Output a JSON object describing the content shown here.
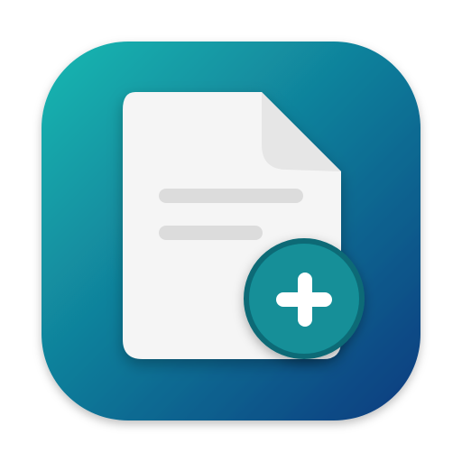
{
  "app_icon": {
    "name": "new-document-app-icon",
    "colors": {
      "background_top_left": "#16b8b1",
      "background_bottom_right": "#0a3a7f",
      "page": "#f5f5f5",
      "page_fold": "#e6e6e6",
      "text_lines": "#dcdcdc",
      "badge_fill": "#128f98",
      "badge_border": "#0b6b76",
      "plus": "#ffffff"
    },
    "document": {
      "icon": "document-icon",
      "text_line_count": 2
    },
    "badge": {
      "icon": "plus-circle-icon"
    }
  }
}
